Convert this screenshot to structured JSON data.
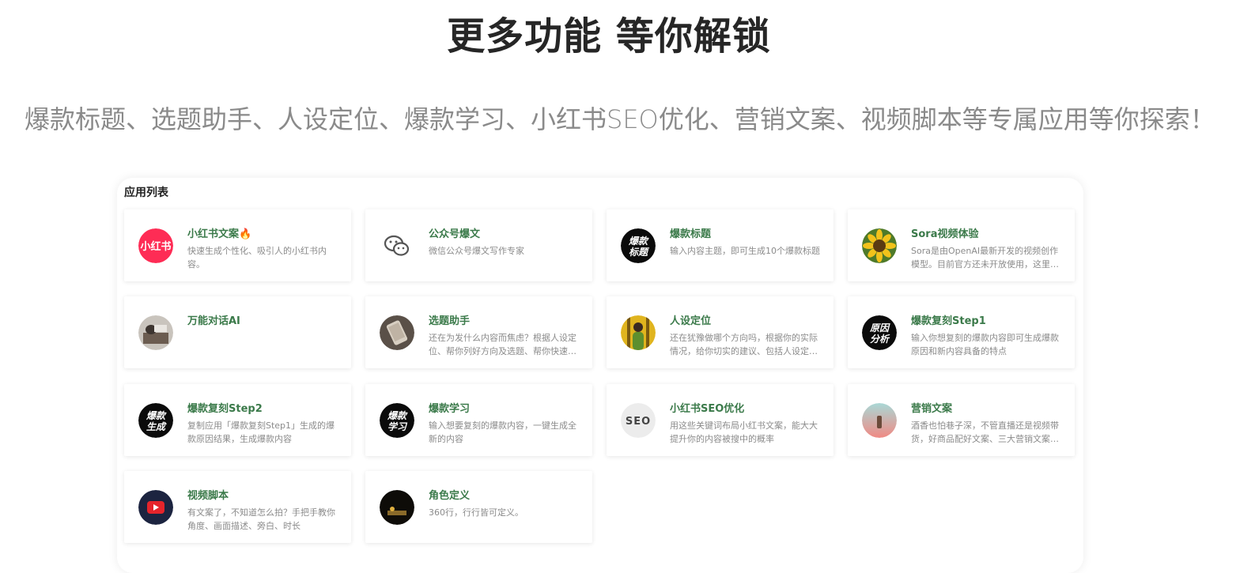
{
  "hero": {
    "title": "更多功能 等你解锁",
    "subtitle": "爆款标题、选题助手、人设定位、爆款学习、小红书SEO优化、营销文案、视频脚本等专属应用等你探索！"
  },
  "panel": {
    "title": "应用列表"
  },
  "apps": [
    {
      "title": "小红书文案🔥",
      "desc": "快速生成个性化、吸引人的小红书内容。",
      "icon": "xiaohongshu-logo-icon"
    },
    {
      "title": "公众号爆文",
      "desc": "微信公众号爆文写作专家",
      "icon": "wechat-icon"
    },
    {
      "title": "爆款标题",
      "desc": "输入内容主题，即可生成10个爆款标题",
      "icon": "baokuan-biaoti-icon"
    },
    {
      "title": "Sora视频体验",
      "desc": "Sora是由OpenAI最新开发的视频创作模型。目前官方还未开放使用，这里可以体验",
      "icon": "sunflower-icon"
    },
    {
      "title": "万能对话AI",
      "desc": "",
      "icon": "chat-ai-photo-icon"
    },
    {
      "title": "选题助手",
      "desc": "还在为发什么内容而焦虑？根据人设定位、帮你列好方向及选题、帮你快速起号",
      "icon": "phone-photo-icon"
    },
    {
      "title": "人设定位",
      "desc": "还在犹豫做哪个方向吗，根据你的实际情况，给你切实的建议、包括人设定位方向",
      "icon": "person-photo-icon"
    },
    {
      "title": "爆款复刻Step1",
      "desc": "输入你想复刻的爆款内容即可生成爆款原因和新内容具备的特点",
      "icon": "yuanyin-fenxi-icon"
    },
    {
      "title": "爆款复刻Step2",
      "desc": "复制应用「爆款复刻Step1」生成的爆款原因结果，生成爆款内容",
      "icon": "baokuan-shengcheng-icon"
    },
    {
      "title": "爆款学习",
      "desc": "输入想要复刻的爆款内容，一键生成全新的内容",
      "icon": "baokuan-xuexi-icon"
    },
    {
      "title": "小红书SEO优化",
      "desc": "用这些关键词布局小红书文案，能大大提升你的内容被搜中的概率",
      "icon": "seo-icon"
    },
    {
      "title": "营销文案",
      "desc": "酒香也怕巷子深，不管直播还是视频带货，好商品配好文案、三大营销文案模板",
      "icon": "marketing-photo-icon"
    },
    {
      "title": "视频脚本",
      "desc": "有文案了，不知道怎么拍？手把手教你角度、画面描述、旁白、时长",
      "icon": "video-play-icon"
    },
    {
      "title": "角色定义",
      "desc": "360行，行行皆可定义。",
      "icon": "role-photo-icon"
    }
  ],
  "icon_text": {
    "xhs": "小红书",
    "baokuan_biaoti": [
      "爆款",
      "标题"
    ],
    "yuanyin_fenxi": [
      "原因",
      "分析"
    ],
    "baokuan_shengcheng": [
      "爆款",
      "生成"
    ],
    "baokuan_xuexi": [
      "爆款",
      "学习"
    ],
    "seo": "SEO"
  },
  "colors": {
    "title_green": "#3b7a4a",
    "xhs_red": "#fe2c55"
  }
}
